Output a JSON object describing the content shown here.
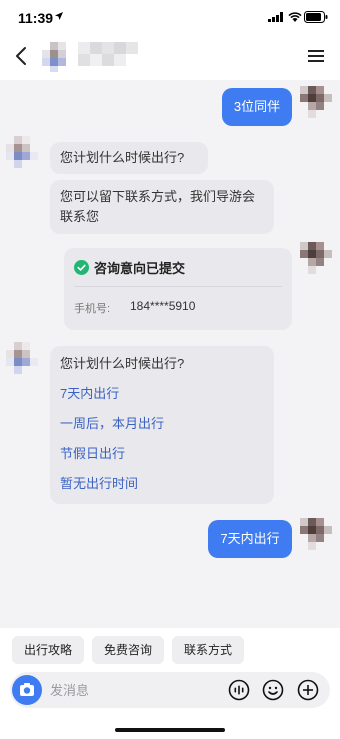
{
  "status_bar": {
    "time": "11:39"
  },
  "header": {
    "avatar_icon": "blurred-avatar",
    "name_icon": "blurred-name"
  },
  "messages": {
    "m1": {
      "text": "3位同伴"
    },
    "m2": {
      "text": "您计划什么时候出行?"
    },
    "m3": {
      "text": "您可以留下联系方式，我们导游会联系您"
    },
    "card": {
      "title": "咨询意向已提交",
      "phone_label": "手机号:",
      "phone_value": "184****5910"
    },
    "m5": {
      "question": "您计划什么时候出行?",
      "options": [
        "7天内出行",
        "一周后，本月出行",
        "节假日出行",
        "暂无出行时间"
      ]
    },
    "m6": {
      "text": "7天内出行"
    }
  },
  "quick_replies": [
    "出行攻略",
    "免费咨询",
    "联系方式"
  ],
  "input": {
    "placeholder": "发消息"
  },
  "colors": {
    "accent": "#3f7cf2",
    "bubble_in": "#e9e9ed",
    "option_link": "#3b62c3",
    "chat_bg": "#f3f3f5"
  }
}
